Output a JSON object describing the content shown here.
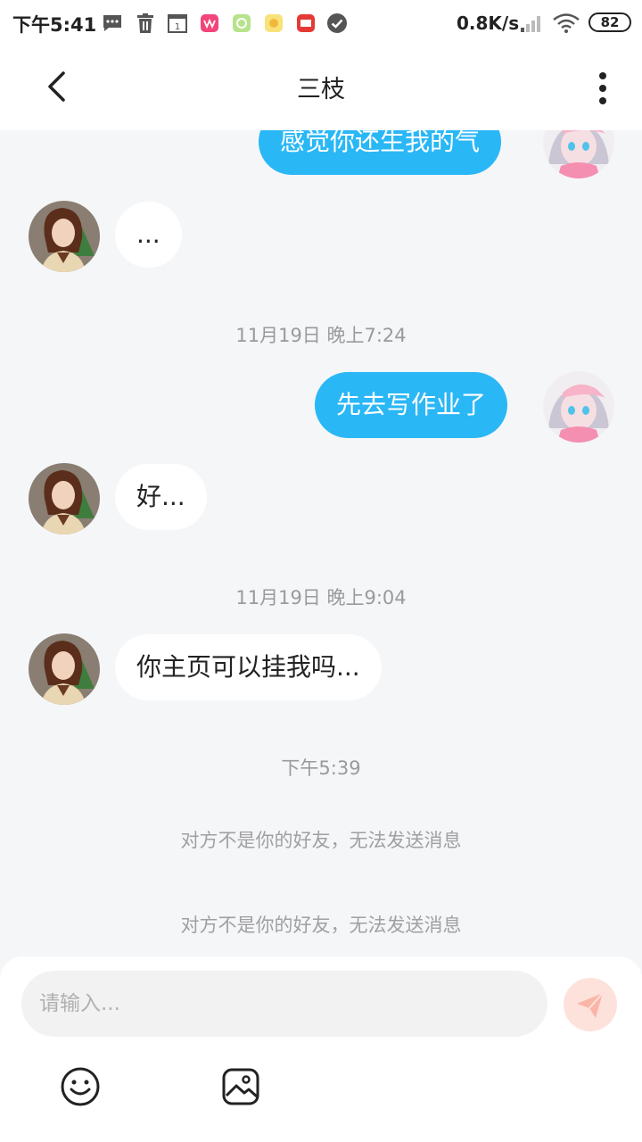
{
  "status_bar": {
    "time": "下午5:41",
    "net_speed": "0.8K/s",
    "battery": "82"
  },
  "nav": {
    "title": "三枝"
  },
  "messages": [
    {
      "side": "out",
      "text": "感觉你还生我的气"
    },
    {
      "side": "in",
      "text": "..."
    },
    {
      "timestamp": "11月19日 晚上7:24"
    },
    {
      "side": "out",
      "text": "先去写作业了"
    },
    {
      "side": "in",
      "text": "好..."
    },
    {
      "timestamp": "11月19日 晚上9:04"
    },
    {
      "side": "in",
      "text": "你主页可以挂我吗..."
    },
    {
      "timestamp": "下午5:39"
    },
    {
      "notice": "对方不是你的好友，无法发送消息"
    },
    {
      "notice": "对方不是你的好友，无法发送消息"
    }
  ],
  "input": {
    "placeholder": "请输入..."
  },
  "colors": {
    "outgoing_bubble": "#2ab7f6",
    "incoming_bubble": "#ffffff",
    "chat_background": "#f5f6f8",
    "send_button": "#fde2dc"
  }
}
